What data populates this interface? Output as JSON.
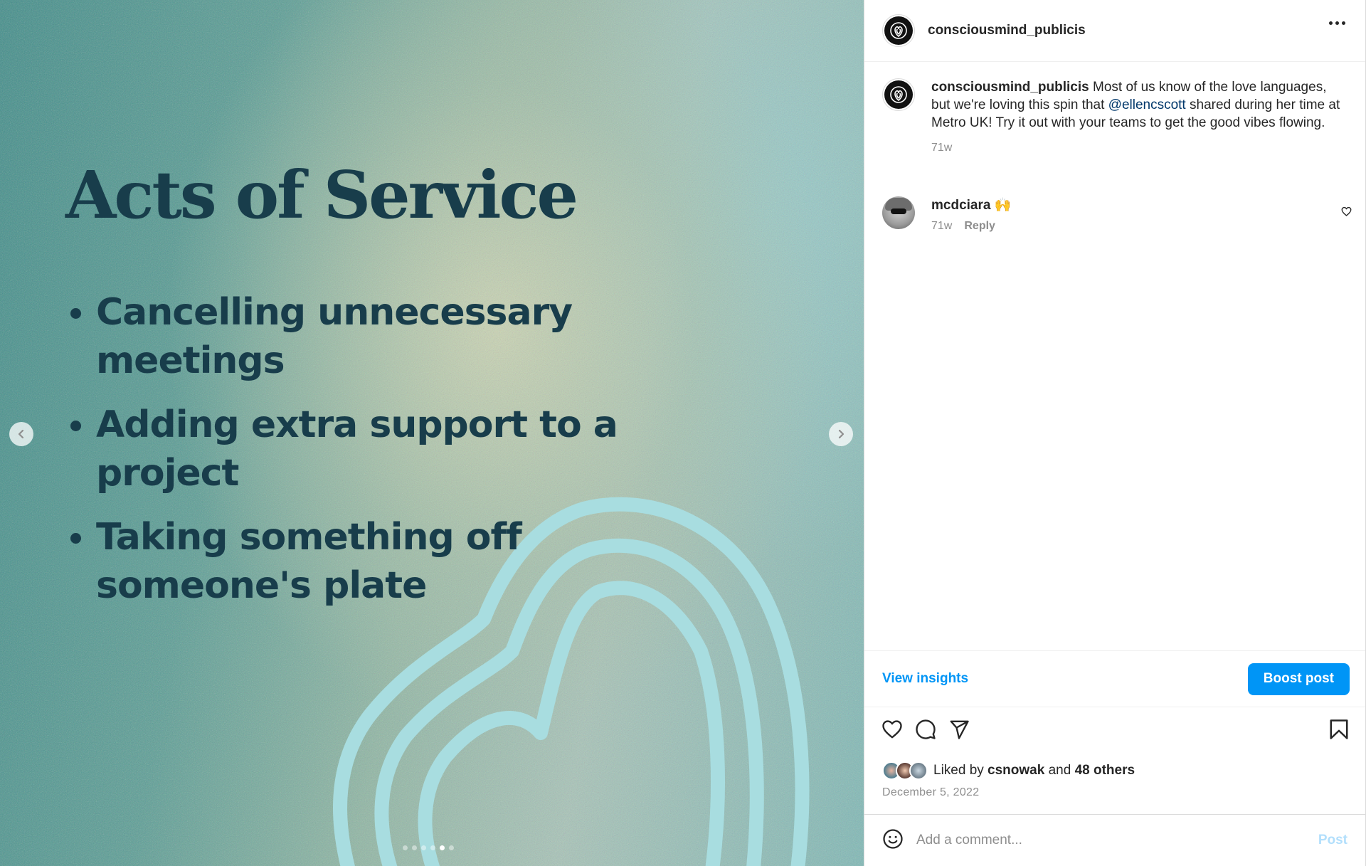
{
  "slide": {
    "title": "Acts of Service",
    "bullets": [
      "Cancelling unnecessary meetings",
      "Adding extra support to a project",
      "Taking something off someone's plate"
    ],
    "carousel_total": 6,
    "carousel_active": 5,
    "heart_color": "#a8dde0",
    "text_color": "#183d4b"
  },
  "header": {
    "username": "consciousmind_publicis",
    "more_icon": "more-horizontal-icon"
  },
  "caption": {
    "username": "consciousmind_publicis",
    "text_before": " Most of us know of the love languages, but we're loving this spin that ",
    "mention": "@ellencscott",
    "text_after": " shared during her time at Metro UK! Try it out with your teams to get the good vibes flowing.",
    "age": "71w"
  },
  "comment": {
    "username": "mcdciara",
    "text": " 🙌",
    "age": "71w",
    "reply_label": "Reply"
  },
  "insights": {
    "view_label": "View insights",
    "boost_label": "Boost post"
  },
  "likes": {
    "prefix": "Liked by ",
    "first_liker": "csnowak",
    "middle": " and ",
    "others": "48 others"
  },
  "date": "December 5, 2022",
  "add_comment": {
    "placeholder": "Add a comment...",
    "post_label": "Post"
  },
  "colors": {
    "accent": "#0095f6",
    "post_disabled": "#b2dffc",
    "mention": "#00376b"
  }
}
